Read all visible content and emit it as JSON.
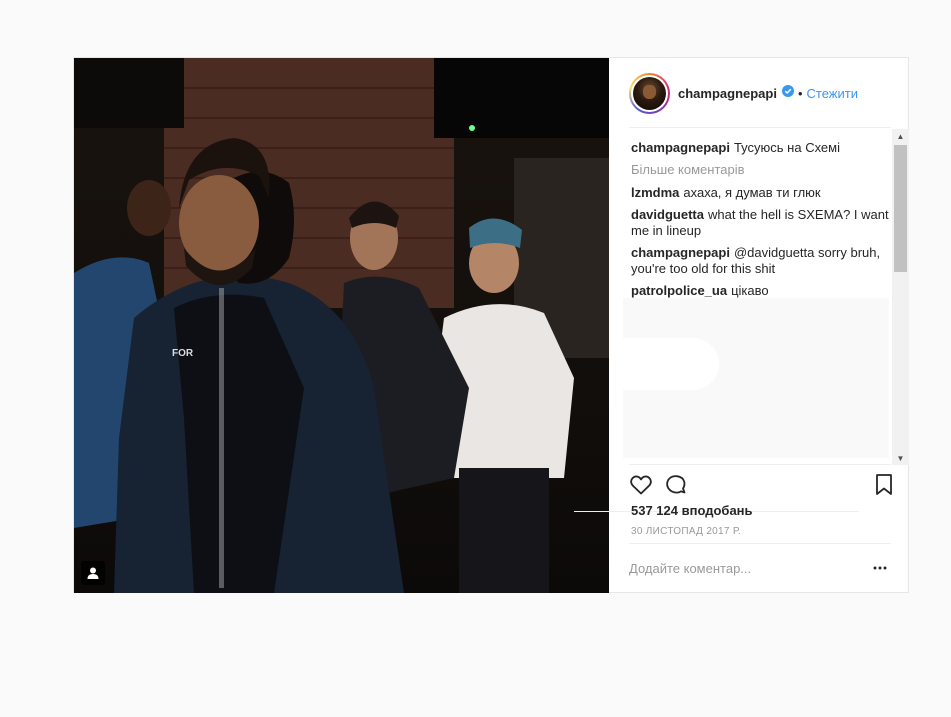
{
  "post": {
    "username": "champagnepapi",
    "separator": "•",
    "follow_label": "Стежити",
    "caption": {
      "user": "champagnepapi",
      "text": "Тусуюсь на Схемі"
    },
    "more_comments_label": "Більше коментарів",
    "comments": [
      {
        "user": "lzmdma",
        "text": "ахаха, я думав ти глюк"
      },
      {
        "user": "davidguetta",
        "text": "what the hell is SXEMA? I want me in lineup"
      },
      {
        "user": "champagnepapi",
        "text": "@davidguetta sorry bruh, you're too old for this shit"
      },
      {
        "user": "patrolpolice_ua",
        "text": "цікаво"
      }
    ],
    "likes": "537 124 вподобань",
    "date": "30 листопад 2017 р.",
    "comment_placeholder": "Додайте коментар...",
    "colors": {
      "link": "#3897f0",
      "verified": "#3897f0",
      "muted": "#999999",
      "text": "#262626"
    },
    "icons": {
      "heart": "heart-icon",
      "comment": "comment-bubble-icon",
      "bookmark": "bookmark-icon",
      "more": "more-options-icon",
      "verified": "verified-badge-icon",
      "tagged": "tagged-user-icon"
    }
  }
}
